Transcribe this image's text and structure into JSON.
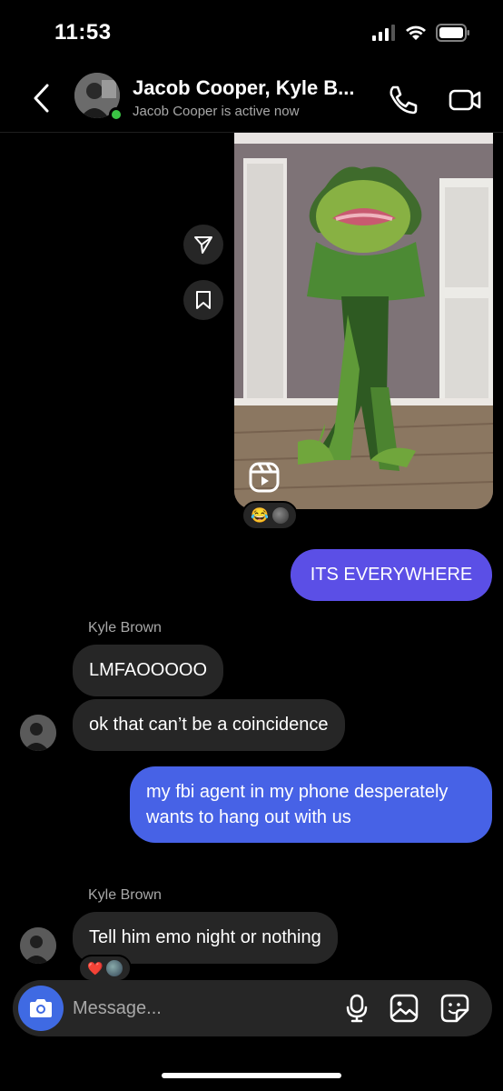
{
  "status_bar": {
    "time": "11:53"
  },
  "header": {
    "title": "Jacob Cooper, Kyle B...",
    "subtitle": "Jacob Cooper is active now"
  },
  "reel": {
    "reactions": [
      "😂"
    ]
  },
  "messages": [
    {
      "id": "m1",
      "direction": "outgoing",
      "text": "ITS EVERYWHERE",
      "color": "#5b4fe6"
    },
    {
      "id": "m2",
      "direction": "incoming",
      "sender": "Kyle Brown",
      "text": "LMFAOOOOO"
    },
    {
      "id": "m3",
      "direction": "incoming",
      "text": "ok that can’t be a coincidence"
    },
    {
      "id": "m4",
      "direction": "outgoing",
      "text": "my fbi agent in my phone desperately wants to hang out with us",
      "color": "#4762e6"
    },
    {
      "id": "m5",
      "direction": "incoming",
      "sender": "Kyle Brown",
      "text": "Tell him emo night or nothing",
      "reactions": [
        "❤️"
      ]
    }
  ],
  "composer": {
    "placeholder": "Message..."
  },
  "colors": {
    "accent_blue": "#3f6ae3",
    "active_green": "#3ac444",
    "incoming_bubble": "#262626"
  },
  "icons": [
    "back-chevron-icon",
    "phone-icon",
    "video-camera-icon",
    "send-icon",
    "bookmark-icon",
    "reels-icon",
    "camera-icon",
    "microphone-icon",
    "gallery-icon",
    "sticker-icon"
  ]
}
